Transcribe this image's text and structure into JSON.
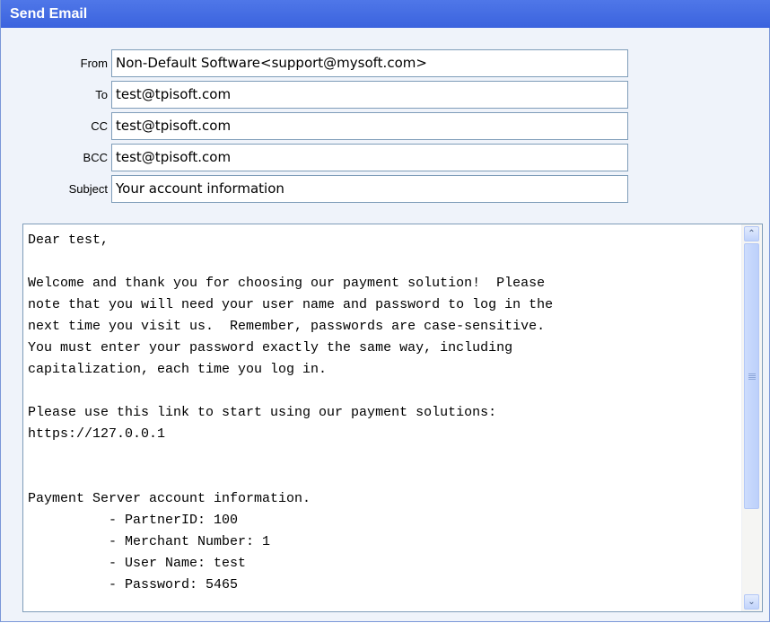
{
  "window": {
    "title": "Send Email"
  },
  "form": {
    "from": {
      "label": "From",
      "value": "Non-Default Software<support@mysoft.com>"
    },
    "to": {
      "label": "To",
      "value": "test@tpisoft.com"
    },
    "cc": {
      "label": "CC",
      "value": "test@tpisoft.com"
    },
    "bcc": {
      "label": "BCC",
      "value": "test@tpisoft.com"
    },
    "subject": {
      "label": "Subject",
      "value": "Your account information"
    }
  },
  "message": {
    "body": "Dear test,\n\nWelcome and thank you for choosing our payment solution!  Please\nnote that you will need your user name and password to log in the\nnext time you visit us.  Remember, passwords are case-sensitive.\nYou must enter your password exactly the same way, including\ncapitalization, each time you log in.\n\nPlease use this link to start using our payment solutions:\nhttps://127.0.0.1\n\n\nPayment Server account information.\n          - PartnerID: 100\n          - Merchant Number: 1\n          - User Name: test\n          - Password: 5465"
  },
  "scrollbar": {
    "up_icon": "scroll-up-arrow",
    "down_icon": "scroll-down-arrow",
    "up_glyph": "⌃",
    "down_glyph": "⌄"
  },
  "colors": {
    "title_bar": "#3b63de",
    "panel_background": "#eff3fa",
    "field_border": "#7f9db9"
  }
}
